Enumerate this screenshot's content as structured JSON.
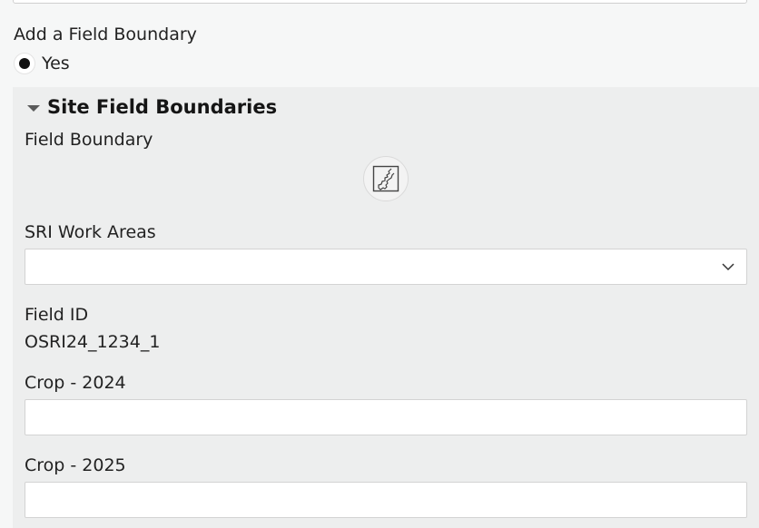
{
  "form": {
    "add_boundary": {
      "label": "Add a Field Boundary",
      "options": [
        {
          "label": "Yes",
          "selected": true
        }
      ]
    },
    "group": {
      "title": "Site Field Boundaries",
      "expanded": true,
      "field_boundary": {
        "label": "Field Boundary",
        "icon": "map-polygon-icon"
      },
      "sri_work_areas": {
        "label": "SRI Work Areas",
        "value": "",
        "icon": "chevron-down-icon"
      },
      "field_id": {
        "label": "Field ID",
        "value": "OSRI24_1234_1"
      },
      "crop_2024": {
        "label": "Crop - 2024",
        "value": ""
      },
      "crop_2025": {
        "label": "Crop - 2025",
        "value": ""
      }
    }
  },
  "colors": {
    "page_background": "#f6f7f7",
    "group_background": "#edeeee",
    "input_background": "#ffffff",
    "input_border": "#d3d3d3",
    "text": "#222222"
  }
}
